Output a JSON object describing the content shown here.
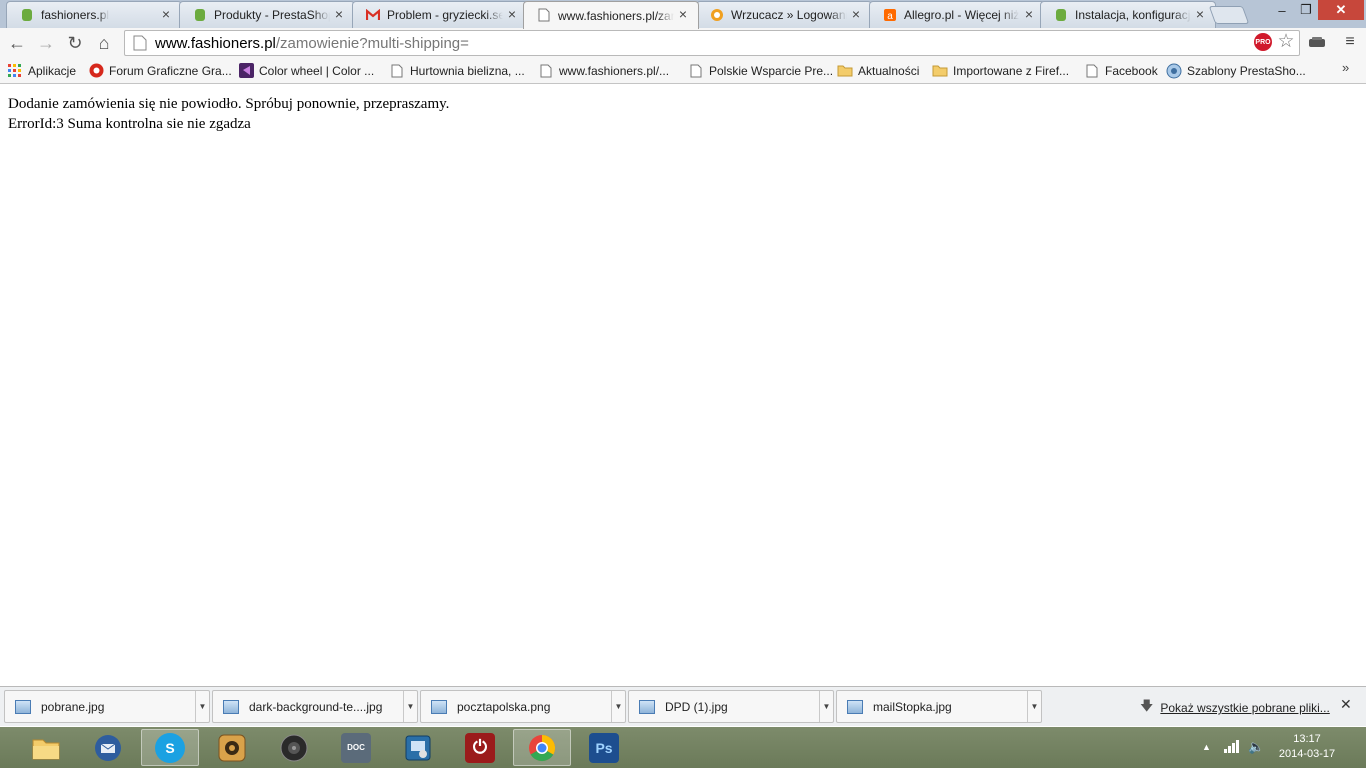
{
  "tabs": [
    {
      "title": "fashioners.pl",
      "icon": "prestashop-icon"
    },
    {
      "title": "Produkty - PrestaShop",
      "icon": "prestashop-icon"
    },
    {
      "title": "Problem - gryziecki.se",
      "icon": "gmail-icon"
    },
    {
      "title": "www.fashioners.pl/zamowienie",
      "icon": "page-icon",
      "active": true
    },
    {
      "title": "Wrzucacz » Logowanie",
      "icon": "wrzucacz-icon"
    },
    {
      "title": "Allegro.pl - Więcej niż",
      "icon": "allegro-icon"
    },
    {
      "title": "Instalacja, konfiguracja",
      "icon": "prestashop-icon"
    }
  ],
  "window_controls": {
    "minimize": "‒",
    "maximize": "❐",
    "close": "✕"
  },
  "toolbar": {
    "back": "←",
    "forward": "→",
    "reload": "↻",
    "home": "⌂",
    "url_host": "www.fashioners.pl",
    "url_path": "/zamowienie?multi-shipping=",
    "pro_badge": "PRO",
    "star": "☆",
    "menu": "≡"
  },
  "bookmarks": [
    {
      "label": "Aplikacje",
      "icon": "apps-grid-icon"
    },
    {
      "label": "Forum Graficzne Gra...",
      "icon": "forum-icon"
    },
    {
      "label": "Color wheel | Color ...",
      "icon": "color-wheel-icon"
    },
    {
      "label": "Hurtownia bielizna, ...",
      "icon": "page-icon"
    },
    {
      "label": "www.fashioners.pl/...",
      "icon": "page-icon"
    },
    {
      "label": "Polskie Wsparcie Pre...",
      "icon": "page-icon"
    },
    {
      "label": "Aktualności",
      "icon": "folder-icon"
    },
    {
      "label": "Importowane z Firef...",
      "icon": "folder-icon"
    },
    {
      "label": "Facebook",
      "icon": "page-icon"
    },
    {
      "label": "Szablony PrestaSho...",
      "icon": "prestashop-icon"
    }
  ],
  "bookmarks_more": "»",
  "page": {
    "line1": "Dodanie zamówienia się nie powiodło. Spróbuj ponownie, przepraszamy.",
    "line2": "ErrorId:3 Suma kontrolna sie nie zgadza"
  },
  "downloads": [
    {
      "name": "pobrane.jpg"
    },
    {
      "name": "dark-background-te....jpg"
    },
    {
      "name": "pocztapolska.png"
    },
    {
      "name": "DPD (1).jpg"
    },
    {
      "name": "mailStopka.jpg"
    }
  ],
  "download_arrow": "▼",
  "show_all_downloads": "Pokaż wszystkie pobrane pliki...",
  "shelf_close": "✕",
  "taskbar": [
    {
      "app": "file-explorer",
      "icon": "folder-icon",
      "color": "#e9c25a",
      "text": ""
    },
    {
      "app": "thunderbird",
      "icon": "thunderbird-icon",
      "color": "#2e5d9e",
      "text": ""
    },
    {
      "app": "skype",
      "icon": "skype-icon",
      "color": "#1ba1e2",
      "text": "S",
      "active": true
    },
    {
      "app": "media",
      "icon": "media-icon",
      "color": "#b98a3e",
      "text": ""
    },
    {
      "app": "speaker",
      "icon": "speaker-icon",
      "color": "#3b3b3b",
      "text": ""
    },
    {
      "app": "doc",
      "icon": "doc-icon",
      "color": "#5b6b7a",
      "text": "DOC"
    },
    {
      "app": "settings",
      "icon": "settings-icon",
      "color": "#2a6fa8",
      "text": ""
    },
    {
      "app": "power",
      "icon": "power-icon",
      "color": "#9b1b1b",
      "text": "⏻"
    },
    {
      "app": "chrome",
      "icon": "chrome-icon",
      "color": "#e8453c",
      "text": "",
      "active": true
    },
    {
      "app": "photoshop",
      "icon": "photoshop-icon",
      "color": "#1d4e8f",
      "text": "Ps"
    }
  ],
  "tray": {
    "arrow": "▲",
    "volume": "🔈",
    "time": "13:17",
    "date": "2014-03-17"
  }
}
